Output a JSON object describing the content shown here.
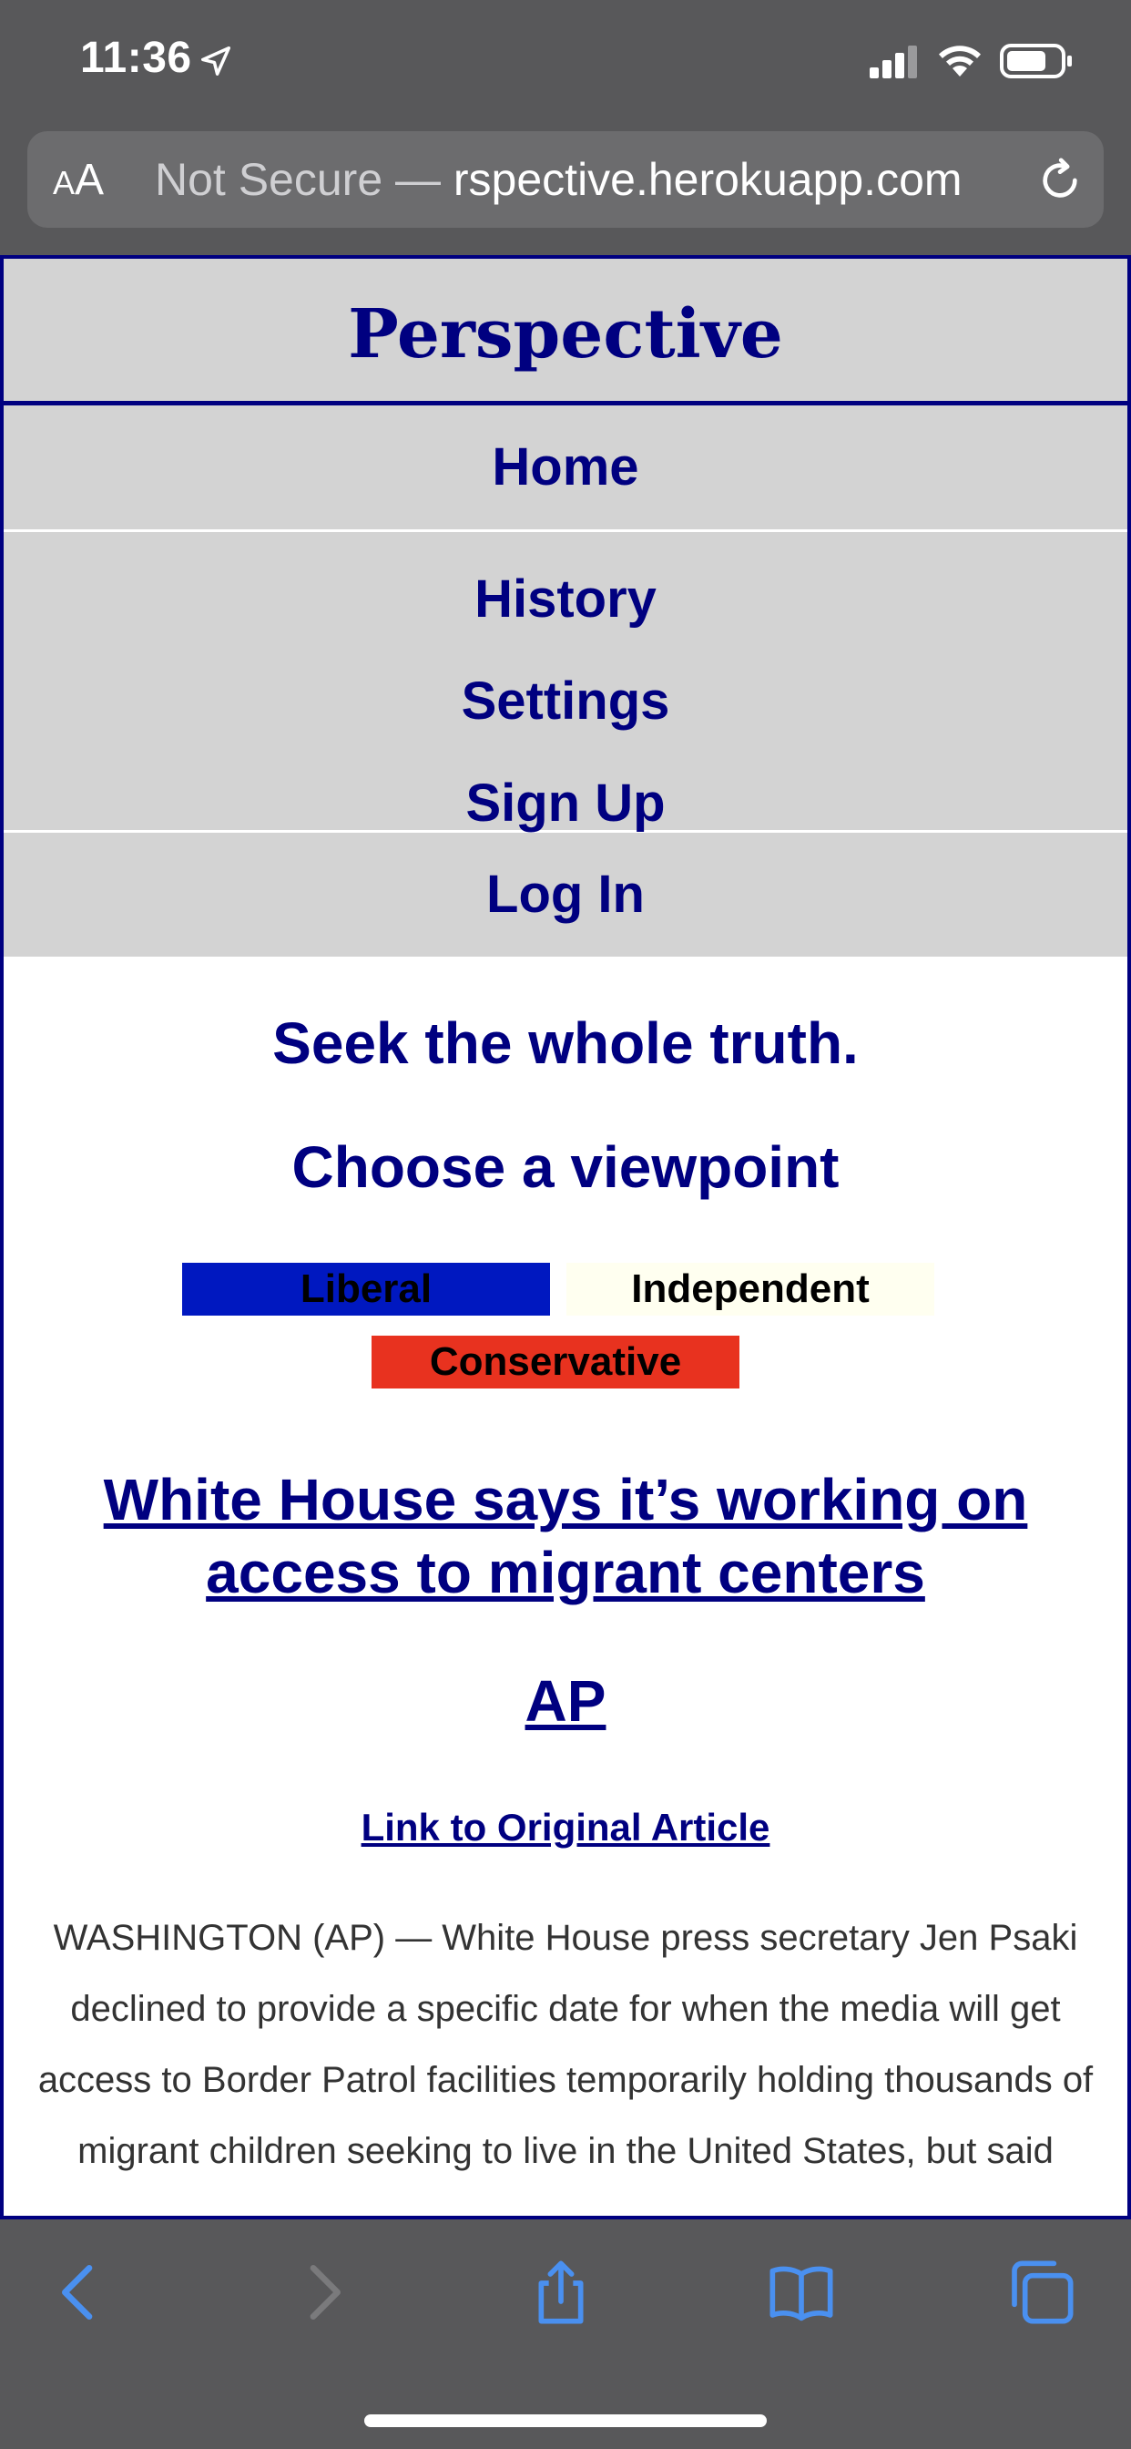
{
  "status_bar": {
    "time": "11:36"
  },
  "url_bar": {
    "aa_label": "AA",
    "url_dim": "Not Secure — ",
    "url_main": "rspective.herokuapp.com"
  },
  "site": {
    "title": "Perspective",
    "nav": {
      "home": "Home",
      "history": "History",
      "settings": "Settings",
      "signup": "Sign Up",
      "login": "Log In"
    }
  },
  "main": {
    "tagline": "Seek the whole truth.",
    "choose_heading": "Choose a viewpoint",
    "viewpoints": [
      {
        "label": "Liberal",
        "color": "#0018c0"
      },
      {
        "label": "Independent",
        "color": "#fffff0"
      },
      {
        "label": "Conservative",
        "color": "#e8321f"
      }
    ],
    "headline": "White House says it’s working on access to migrant centers",
    "source": "AP",
    "original_link": "Link to Original Article",
    "article_text": "WASHINGTON (AP) — White House press secretary Jen Psaki declined to provide a specific date for when the media will get access to Border Patrol facilities temporarily holding thousands of migrant children seeking to live in the United States, but said"
  },
  "toolbar": {
    "icons": [
      "back-icon",
      "forward-icon",
      "share-icon",
      "bookmarks-icon",
      "tabs-icon"
    ]
  },
  "colors": {
    "navy": "#000080",
    "nav_bg": "#d3d3d3",
    "ios_blue": "#4a90f0"
  }
}
